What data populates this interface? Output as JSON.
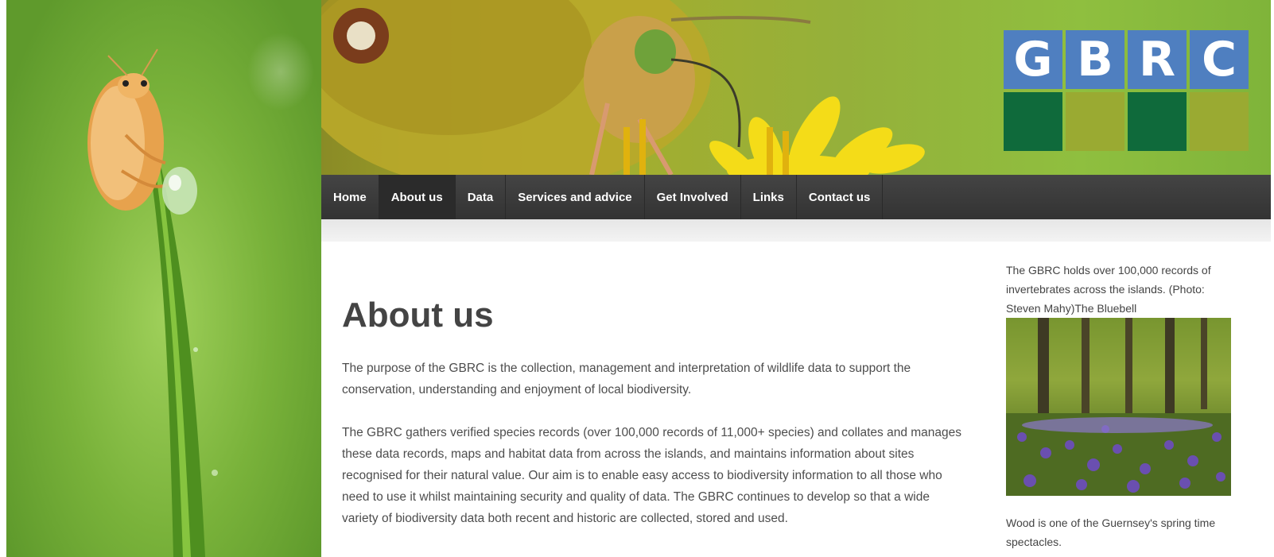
{
  "brand": {
    "logo_letters": [
      "G",
      "B",
      "R",
      "C"
    ],
    "colors": {
      "letter_tile": "#4f7fc0",
      "dark_tile": "#0f6a3b",
      "olive_tile": "#9aaa32",
      "nav_bg": "#3a3a3a",
      "nav_active": "#2b2b2b"
    }
  },
  "images": {
    "side": "beetle-on-grass-photo",
    "banner": "butterfly-on-yellow-flower-photo",
    "sidebar": "bluebell-wood-photo"
  },
  "nav": {
    "items": [
      {
        "label": "Home",
        "active": false
      },
      {
        "label": "About us",
        "active": true
      },
      {
        "label": "Data",
        "active": false
      },
      {
        "label": "Services and advice",
        "active": false
      },
      {
        "label": "Get Involved",
        "active": false
      },
      {
        "label": "Links",
        "active": false
      },
      {
        "label": "Contact us",
        "active": false
      }
    ]
  },
  "main": {
    "title": "About us",
    "paragraphs": [
      "The purpose of the GBRC is the collection, management and interpretation of wildlife data to support the conservation, understanding and enjoyment of local biodiversity.",
      "The GBRC gathers verified species records (over 100,000 records of 11,000+ species) and collates and manages these data records, maps and habitat data from across the islands, and maintains information about sites recognised for their natural value. Our aim is to enable easy access to biodiversity information to all those who need to use it whilst maintaining security and quality of data. The GBRC continues to develop so that a wide variety of biodiversity data both recent and historic are collected, stored and used."
    ]
  },
  "sidebar": {
    "caption_top": "The GBRC holds over 100,000 records of invertebrates across the islands. (Photo: Steven Mahy)The Bluebell",
    "caption_bottom": "Wood is one of the Guernsey's spring time spectacles."
  }
}
